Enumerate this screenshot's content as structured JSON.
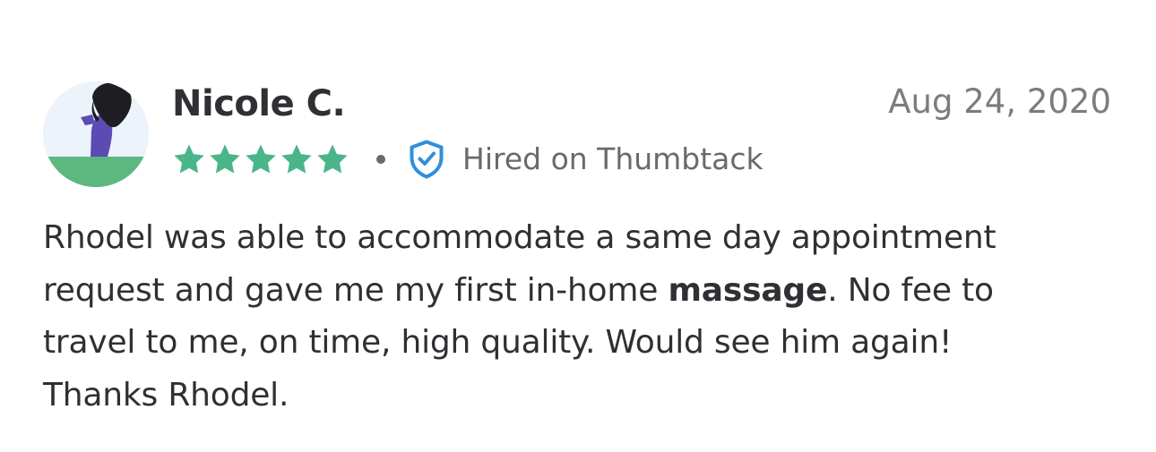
{
  "review": {
    "reviewer_name": "Nicole C.",
    "date": "Aug 24, 2020",
    "rating": 5,
    "rating_max": 5,
    "hired_label": "Hired on Thumbtack",
    "body": {
      "line1": "Rhodel was able to accommodate a same day appointment",
      "line2_before": "request and gave me my first in-home ",
      "line2_bold": "massage",
      "line2_after": ". No fee to",
      "line3": "travel to me, on time, high quality. Would see him again!",
      "line4": "Thanks Rhodel."
    }
  },
  "icons": {
    "avatar": "avatar-illustration",
    "star": "star-icon",
    "verified": "shield-check-icon"
  },
  "colors": {
    "star": "#4bb58a",
    "verified": "#2f8fdc",
    "text": "#2f3033",
    "muted": "#676a6e",
    "avatar_ground": "#5cb87f",
    "avatar_figure": "#5b4bb3",
    "avatar_hair": "#1e1e22"
  }
}
